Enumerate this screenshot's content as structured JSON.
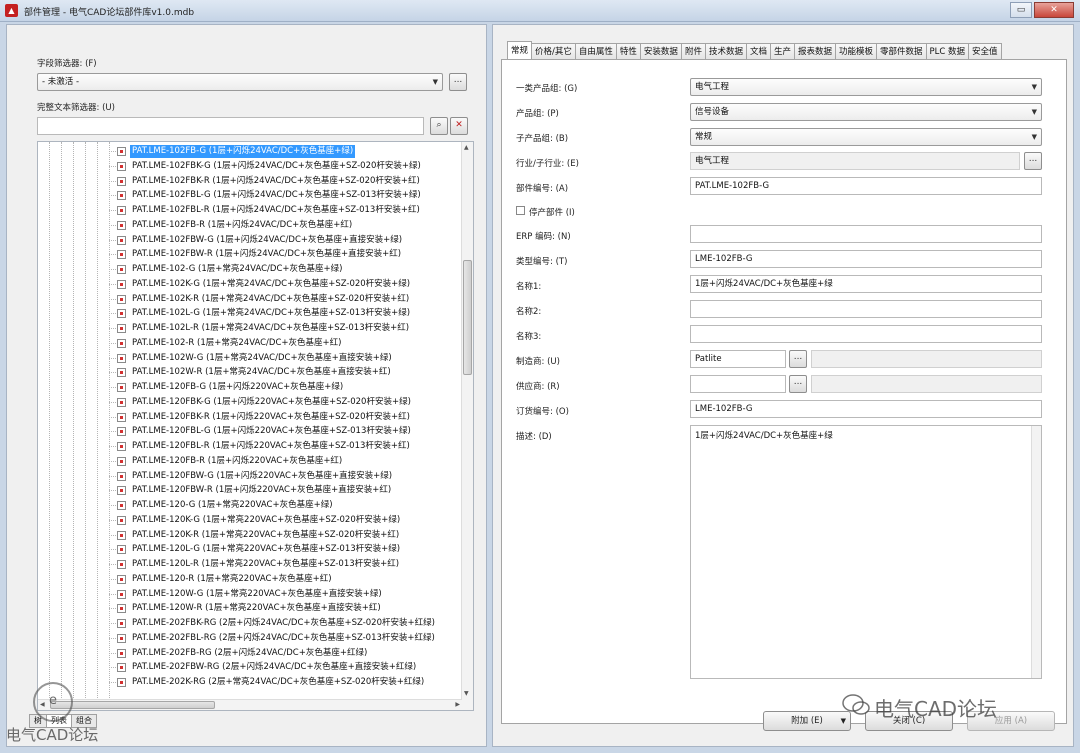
{
  "window": {
    "title": "部件管理 - 电气CAD论坛部件库v1.0.mdb",
    "close_label": "✕"
  },
  "left": {
    "field_filter_label": "字段筛选器: (F)",
    "field_filter_value": "- 未激活 -",
    "fulltext_filter_label": "完整文本筛选器: (U)",
    "fulltext_filter_value": "",
    "tree_items": [
      "PAT.LME-102FB-G (1层+闪烁24VAC/DC+灰色基座+绿)",
      "PAT.LME-102FBK-G (1层+闪烁24VAC/DC+灰色基座+SZ-020杆安装+绿)",
      "PAT.LME-102FBK-R (1层+闪烁24VAC/DC+灰色基座+SZ-020杆安装+红)",
      "PAT.LME-102FBL-G (1层+闪烁24VAC/DC+灰色基座+SZ-013杆安装+绿)",
      "PAT.LME-102FBL-R (1层+闪烁24VAC/DC+灰色基座+SZ-013杆安装+红)",
      "PAT.LME-102FB-R (1层+闪烁24VAC/DC+灰色基座+红)",
      "PAT.LME-102FBW-G (1层+闪烁24VAC/DC+灰色基座+直接安装+绿)",
      "PAT.LME-102FBW-R (1层+闪烁24VAC/DC+灰色基座+直接安装+红)",
      "PAT.LME-102-G (1层+常亮24VAC/DC+灰色基座+绿)",
      "PAT.LME-102K-G (1层+常亮24VAC/DC+灰色基座+SZ-020杆安装+绿)",
      "PAT.LME-102K-R (1层+常亮24VAC/DC+灰色基座+SZ-020杆安装+红)",
      "PAT.LME-102L-G (1层+常亮24VAC/DC+灰色基座+SZ-013杆安装+绿)",
      "PAT.LME-102L-R (1层+常亮24VAC/DC+灰色基座+SZ-013杆安装+红)",
      "PAT.LME-102-R (1层+常亮24VAC/DC+灰色基座+红)",
      "PAT.LME-102W-G (1层+常亮24VAC/DC+灰色基座+直接安装+绿)",
      "PAT.LME-102W-R (1层+常亮24VAC/DC+灰色基座+直接安装+红)",
      "PAT.LME-120FB-G (1层+闪烁220VAC+灰色基座+绿)",
      "PAT.LME-120FBK-G (1层+闪烁220VAC+灰色基座+SZ-020杆安装+绿)",
      "PAT.LME-120FBK-R (1层+闪烁220VAC+灰色基座+SZ-020杆安装+红)",
      "PAT.LME-120FBL-G (1层+闪烁220VAC+灰色基座+SZ-013杆安装+绿)",
      "PAT.LME-120FBL-R (1层+闪烁220VAC+灰色基座+SZ-013杆安装+红)",
      "PAT.LME-120FB-R (1层+闪烁220VAC+灰色基座+红)",
      "PAT.LME-120FBW-G (1层+闪烁220VAC+灰色基座+直接安装+绿)",
      "PAT.LME-120FBW-R (1层+闪烁220VAC+灰色基座+直接安装+红)",
      "PAT.LME-120-G (1层+常亮220VAC+灰色基座+绿)",
      "PAT.LME-120K-G (1层+常亮220VAC+灰色基座+SZ-020杆安装+绿)",
      "PAT.LME-120K-R (1层+常亮220VAC+灰色基座+SZ-020杆安装+红)",
      "PAT.LME-120L-G (1层+常亮220VAC+灰色基座+SZ-013杆安装+绿)",
      "PAT.LME-120L-R (1层+常亮220VAC+灰色基座+SZ-013杆安装+红)",
      "PAT.LME-120-R (1层+常亮220VAC+灰色基座+红)",
      "PAT.LME-120W-G (1层+常亮220VAC+灰色基座+直接安装+绿)",
      "PAT.LME-120W-R (1层+常亮220VAC+灰色基座+直接安装+红)",
      "PAT.LME-202FBK-RG (2层+闪烁24VAC/DC+灰色基座+SZ-020杆安装+红绿)",
      "PAT.LME-202FBL-RG (2层+闪烁24VAC/DC+灰色基座+SZ-013杆安装+红绿)",
      "PAT.LME-202FB-RG (2层+闪烁24VAC/DC+灰色基座+红绿)",
      "PAT.LME-202FBW-RG (2层+闪烁24VAC/DC+灰色基座+直接安装+红绿)",
      "PAT.LME-202K-RG (2层+常亮24VAC/DC+灰色基座+SZ-020杆安装+红绿)"
    ],
    "bottom_tabs": [
      "树",
      "列表",
      "组合"
    ]
  },
  "right": {
    "tabs": [
      "常规",
      "价格/其它",
      "自由属性",
      "特性",
      "安装数据",
      "附件",
      "技术数据",
      "文档",
      "生产",
      "报表数据",
      "功能模板",
      "零部件数据",
      "PLC 数据",
      "安全值"
    ],
    "fields": {
      "product_group_1_label": "一类产品组: (G)",
      "product_group_1_value": "电气工程",
      "product_group_label": "产品组: (P)",
      "product_group_value": "信号设备",
      "sub_product_group_label": "子产品组: (B)",
      "sub_product_group_value": "常规",
      "industry_label": "行业/子行业: (E)",
      "industry_value": "电气工程",
      "part_number_label": "部件编号: (A)",
      "part_number_value": "PAT.LME-102FB-G",
      "discontinued_label": "停产部件 (I)",
      "erp_label": "ERP 编码: (N)",
      "erp_value": "",
      "type_number_label": "类型编号: (T)",
      "type_number_value": "LME-102FB-G",
      "name1_label": "名称1:",
      "name1_value": "1层+闪烁24VAC/DC+灰色基座+绿",
      "name2_label": "名称2:",
      "name2_value": "",
      "name3_label": "名称3:",
      "name3_value": "",
      "manufacturer_label": "制造商: (U)",
      "manufacturer_value": "Patlite",
      "supplier_label": "供应商: (R)",
      "supplier_value": "",
      "order_number_label": "订货编号: (O)",
      "order_number_value": "LME-102FB-G",
      "description_label": "描述: (D)",
      "description_value": "1层+闪烁24VAC/DC+灰色基座+绿"
    },
    "buttons": {
      "attach": "附加 (E)",
      "close": "关闭 (C)",
      "apply": "应用 (A)"
    }
  },
  "watermark": {
    "left_text": "电气CAD论坛",
    "right_text": "电气CAD论坛",
    "logo_text": "e"
  },
  "colors": {
    "selection": "#3399ff",
    "window_bg": "#f0f0f0",
    "frame": "#c9d6e6"
  }
}
